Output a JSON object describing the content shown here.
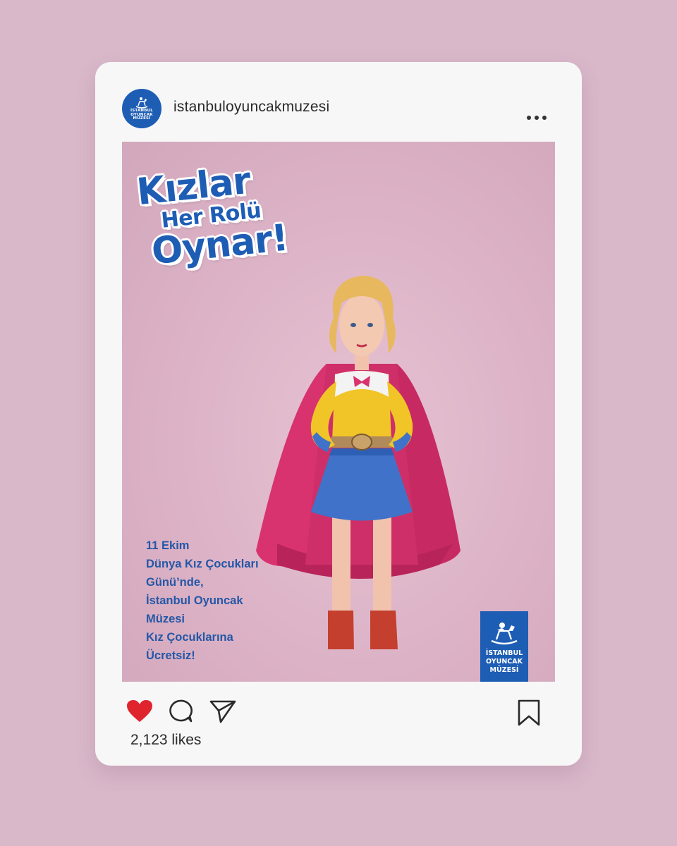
{
  "post": {
    "username": "istanbuloyuncakmuzesi",
    "avatar_text": [
      "İSTANBUL",
      "OYUNCAK",
      "MÜZESİ"
    ],
    "headline": [
      "Kızlar",
      "Her Rolü",
      "Oynar!"
    ],
    "caption_lines": [
      "11 Ekim",
      "Dünya Kız Çocukları",
      "Günü’nde,",
      "İstanbul Oyuncak",
      "Müzesi",
      "Kız Çocuklarına",
      "Ücretsiz!"
    ],
    "logo_lines": [
      "İSTANBUL",
      "OYUNCAK",
      "MÜZESİ"
    ],
    "likes": "2,123 likes"
  },
  "icons": {
    "more": "more-horizontal-icon",
    "like": "heart-icon",
    "comment": "comment-icon",
    "share": "send-icon",
    "save": "bookmark-icon"
  },
  "colors": {
    "background": "#d9b8ca",
    "card": "#f7f7f7",
    "brand_blue": "#1e5db4",
    "heart": "#e0242e"
  }
}
